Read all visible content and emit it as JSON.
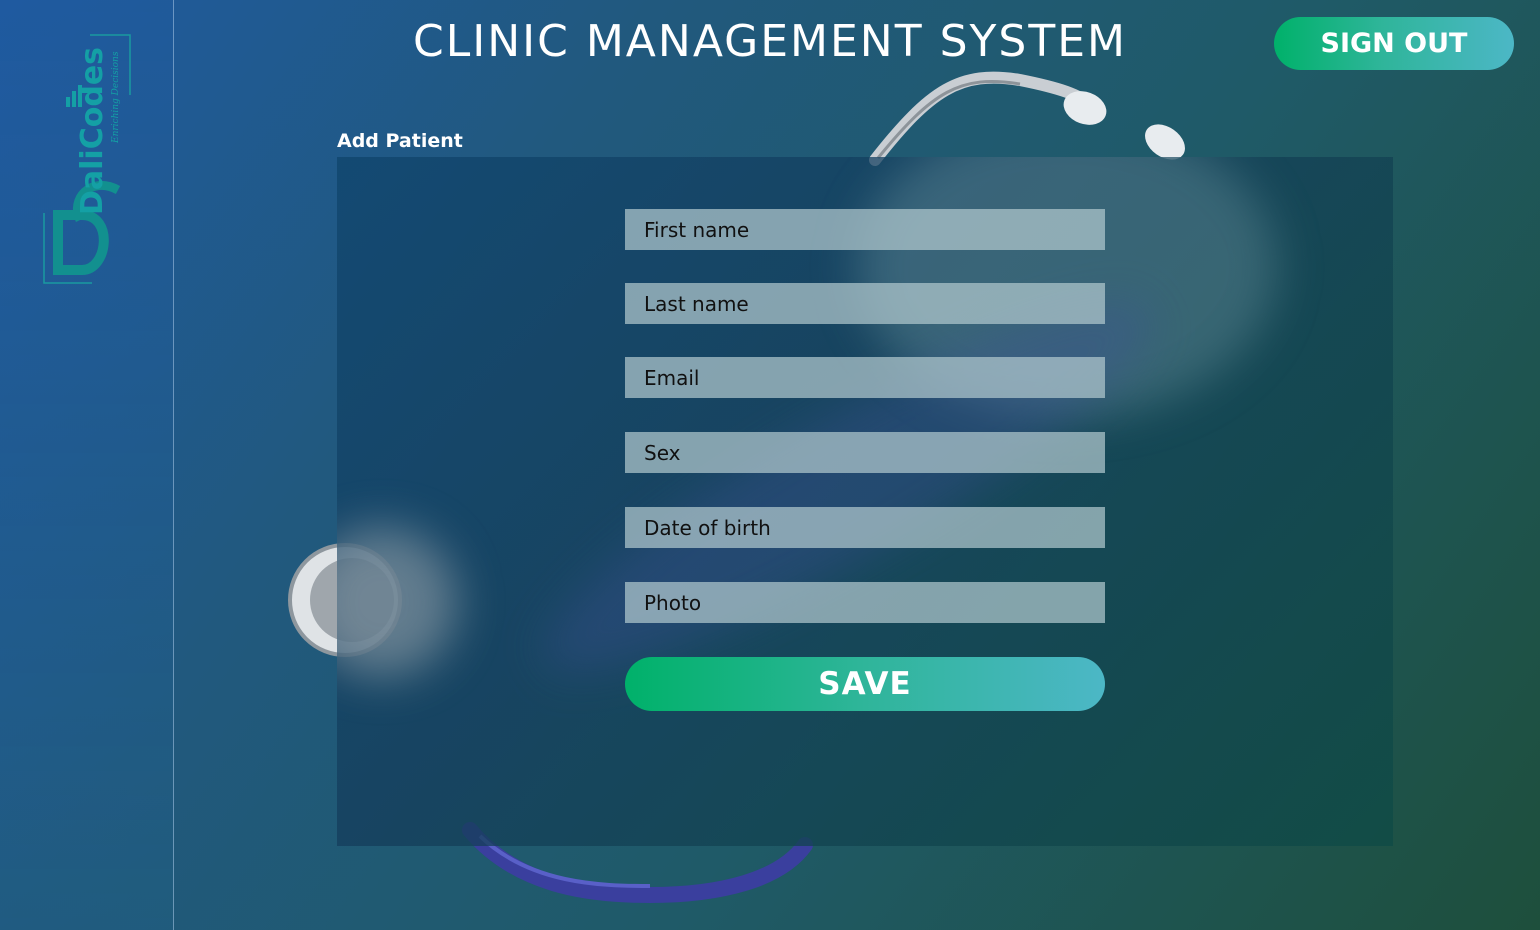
{
  "header": {
    "title": "CLINIC MANAGEMENT SYSTEM",
    "sign_out_label": "SIGN OUT"
  },
  "sidebar": {
    "logo": {
      "brand": "DaliCodes",
      "tagline": "Enriching Decisions"
    }
  },
  "form": {
    "title": "Add Patient",
    "fields": [
      {
        "name": "first-name",
        "placeholder": "First name"
      },
      {
        "name": "last-name",
        "placeholder": "Last name"
      },
      {
        "name": "email",
        "placeholder": "Email"
      },
      {
        "name": "sex",
        "placeholder": "Sex"
      },
      {
        "name": "date-of-birth",
        "placeholder": "Date of birth"
      },
      {
        "name": "photo",
        "placeholder": "Photo"
      }
    ],
    "save_label": "SAVE"
  },
  "colors": {
    "accent_start": "#00b16a",
    "accent_end": "#4cb7c6",
    "field_bg": "#b0c8cd"
  },
  "icons": [
    "stethoscope-illustration",
    "dalicodes-logo"
  ]
}
